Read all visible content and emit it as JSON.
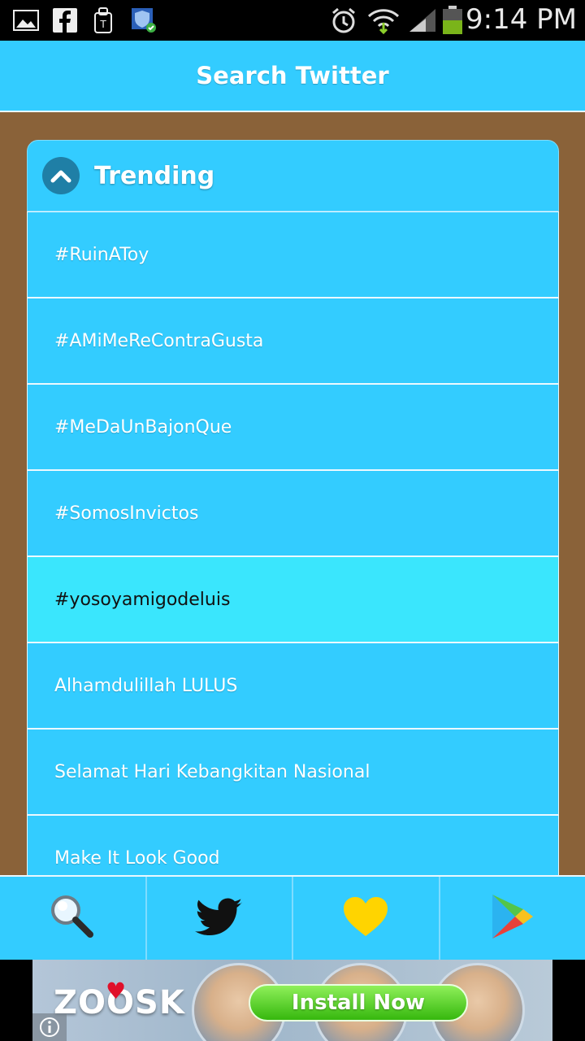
{
  "status_bar": {
    "time": "9:14 PM",
    "icons": [
      "image-icon",
      "facebook-icon",
      "tmobile-icon",
      "shield-icon",
      "alarm-icon",
      "wifi-icon",
      "signal-icon",
      "battery-icon"
    ]
  },
  "header": {
    "title": "Search Twitter"
  },
  "trending": {
    "title": "Trending",
    "items": [
      "#RuinAToy",
      "#AMiMeReContraGusta",
      "#MeDaUnBajonQue",
      "#SomosInvictos",
      "#yosoyamigodeluis",
      "Alhamdulillah LULUS",
      "Selamat Hari Kebangkitan Nasional",
      "Make It Look Good"
    ],
    "active_index": 4
  },
  "bottom_nav": {
    "items": [
      "search-icon",
      "twitter-bird-icon",
      "heart-icon",
      "play-store-icon"
    ]
  },
  "ad": {
    "brand": "ZOOSK",
    "cta": "Install Now"
  },
  "colors": {
    "accent": "#33ccff",
    "active_row": "#3ae6fd",
    "background": "#8a6239",
    "heart": "#ffd400"
  }
}
